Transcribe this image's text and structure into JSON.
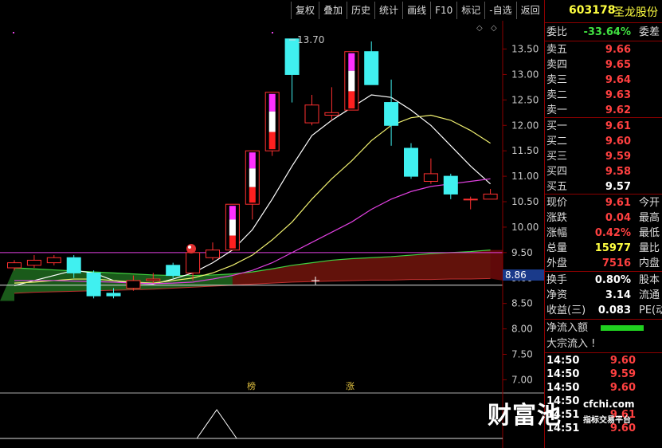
{
  "toolbar": [
    "复权",
    "叠加",
    "历史",
    "统计",
    "画线",
    "F10",
    "标记",
    "-自选",
    "返回"
  ],
  "stock": {
    "code": "603178",
    "name": "圣龙股份"
  },
  "price_axis": [
    "13.50",
    "13.00",
    "12.50",
    "12.00",
    "11.50",
    "11.00",
    "10.50",
    "10.00",
    "9.50",
    "9.00",
    "8.50",
    "8.00",
    "7.50",
    "7.00"
  ],
  "price_tag": "8.86",
  "high_label": "13.70",
  "markers": [
    "榜",
    "涨"
  ],
  "quote": {
    "weibi": {
      "label": "委比",
      "value": "-33.64%",
      "extra": "委差"
    },
    "asks": [
      {
        "label": "卖五",
        "price": "9.66"
      },
      {
        "label": "卖四",
        "price": "9.65"
      },
      {
        "label": "卖三",
        "price": "9.64"
      },
      {
        "label": "卖二",
        "price": "9.63"
      },
      {
        "label": "卖一",
        "price": "9.62"
      }
    ],
    "bids": [
      {
        "label": "买一",
        "price": "9.61"
      },
      {
        "label": "买二",
        "price": "9.60"
      },
      {
        "label": "买三",
        "price": "9.59"
      },
      {
        "label": "买四",
        "price": "9.58"
      },
      {
        "label": "买五",
        "price": "9.57"
      }
    ],
    "stats": [
      {
        "label": "现价",
        "value": "9.61",
        "extra": "今开"
      },
      {
        "label": "涨跌",
        "value": "0.04",
        "extra": "最高"
      },
      {
        "label": "涨幅",
        "value": "0.42%",
        "extra": "最低"
      },
      {
        "label": "总量",
        "value": "15977",
        "extra": "量比"
      },
      {
        "label": "外盘",
        "value": "7516",
        "extra": "内盘"
      }
    ],
    "stats2": [
      {
        "label": "换手",
        "value": "0.80%",
        "extra": "股本"
      },
      {
        "label": "净资",
        "value": "3.14",
        "extra": "流通"
      },
      {
        "label": "收益(三)",
        "value": "0.083",
        "extra": "PE(动"
      }
    ],
    "net_inflow_label": "净流入额",
    "block_inflow_label": "大宗流入 !",
    "ticks": [
      {
        "time": "14:50",
        "price": "9.60"
      },
      {
        "time": "14:50",
        "price": "9.59"
      },
      {
        "time": "14:50",
        "price": "9.60"
      },
      {
        "time": "14:50",
        "price": ""
      },
      {
        "time": "14:51",
        "price": "9.61"
      },
      {
        "time": "14:51",
        "price": "9.60"
      }
    ]
  },
  "watermark": {
    "brand": "财富池",
    "domain": "cfchi.com",
    "tagline": "指标交易平台"
  },
  "chart_data": {
    "type": "candlestick",
    "ylim": [
      6.85,
      13.9
    ],
    "candles": [
      {
        "o": 9.2,
        "c": 9.3,
        "h": 9.35,
        "l": 9.15
      },
      {
        "o": 9.25,
        "c": 9.35,
        "h": 9.45,
        "l": 9.2
      },
      {
        "o": 9.3,
        "c": 9.4,
        "h": 9.45,
        "l": 9.25
      },
      {
        "o": 9.4,
        "c": 9.1,
        "h": 9.45,
        "l": 9.0
      },
      {
        "o": 9.1,
        "c": 8.65,
        "h": 9.15,
        "l": 8.6
      },
      {
        "o": 8.7,
        "c": 8.65,
        "h": 8.8,
        "l": 8.6
      },
      {
        "o": 8.8,
        "c": 8.95,
        "h": 9.05,
        "l": 8.75
      },
      {
        "o": 8.95,
        "c": 8.98,
        "h": 9.1,
        "l": 8.9
      },
      {
        "o": 9.25,
        "c": 9.05,
        "h": 9.3,
        "l": 9.0
      },
      {
        "o": 9.1,
        "c": 9.5,
        "h": 9.6,
        "l": 8.95
      },
      {
        "o": 9.4,
        "c": 9.55,
        "h": 9.7,
        "l": 9.35
      },
      {
        "o": 9.55,
        "c": 10.45,
        "h": 10.45,
        "l": 9.55
      },
      {
        "o": 10.45,
        "c": 11.5,
        "h": 11.5,
        "l": 10.15
      },
      {
        "o": 11.5,
        "c": 12.65,
        "h": 12.65,
        "l": 11.4
      },
      {
        "o": 13.7,
        "c": 13.0,
        "h": 13.7,
        "l": 12.45
      },
      {
        "o": 12.05,
        "c": 12.4,
        "h": 12.6,
        "l": 12.0
      },
      {
        "o": 12.2,
        "c": 12.25,
        "h": 12.75,
        "l": 12.1
      },
      {
        "o": 12.3,
        "c": 13.45,
        "h": 13.45,
        "l": 12.3
      },
      {
        "o": 13.45,
        "c": 12.8,
        "h": 13.65,
        "l": 12.8
      },
      {
        "o": 12.45,
        "c": 12.0,
        "h": 12.9,
        "l": 11.6
      },
      {
        "o": 11.55,
        "c": 11.0,
        "h": 11.65,
        "l": 10.95
      },
      {
        "o": 10.9,
        "c": 11.05,
        "h": 11.35,
        "l": 10.85
      },
      {
        "o": 11.0,
        "c": 10.65,
        "h": 11.05,
        "l": 10.55
      },
      {
        "o": 10.55,
        "c": 10.55,
        "h": 10.6,
        "l": 10.35
      },
      {
        "o": 10.55,
        "c": 10.65,
        "h": 10.75,
        "l": 10.55
      }
    ],
    "ma_white": [
      8.85,
      8.95,
      9.05,
      9.15,
      9.1,
      8.95,
      8.9,
      8.88,
      8.98,
      9.1,
      9.3,
      9.55,
      9.95,
      10.55,
      11.2,
      11.8,
      12.1,
      12.35,
      12.6,
      12.55,
      12.3,
      12.0,
      11.6,
      11.2,
      10.85
    ],
    "ma_yellow": [
      8.9,
      8.92,
      8.95,
      8.98,
      8.98,
      8.95,
      8.92,
      8.9,
      8.95,
      9.0,
      9.1,
      9.25,
      9.45,
      9.75,
      10.1,
      10.55,
      10.95,
      11.3,
      11.7,
      12.0,
      12.15,
      12.2,
      12.1,
      11.9,
      11.65
    ],
    "ma_magenta": [
      8.95,
      8.95,
      8.95,
      8.94,
      8.93,
      8.92,
      8.9,
      8.89,
      8.9,
      8.92,
      8.98,
      9.05,
      9.15,
      9.3,
      9.5,
      9.7,
      9.9,
      10.1,
      10.35,
      10.55,
      10.7,
      10.8,
      10.85,
      10.9,
      10.95
    ],
    "band_upper": [
      9.2,
      9.18,
      9.16,
      9.14,
      9.12,
      9.1,
      9.08,
      9.06,
      9.05,
      9.05,
      9.06,
      9.08,
      9.12,
      9.18,
      9.25,
      9.3,
      9.35,
      9.38,
      9.4,
      9.42,
      9.45,
      9.48,
      9.5,
      9.52,
      9.55
    ],
    "band_lower": [
      8.7,
      8.72,
      8.73,
      8.74,
      8.75,
      8.76,
      8.77,
      8.78,
      8.8,
      8.82,
      8.84,
      8.86,
      8.88,
      8.9,
      8.92,
      8.93,
      8.94,
      8.95,
      8.96,
      8.96,
      8.97,
      8.97,
      8.98,
      8.98,
      8.99
    ],
    "resistance": 9.5,
    "current": 8.86,
    "indicator_peak_index": 9
  }
}
